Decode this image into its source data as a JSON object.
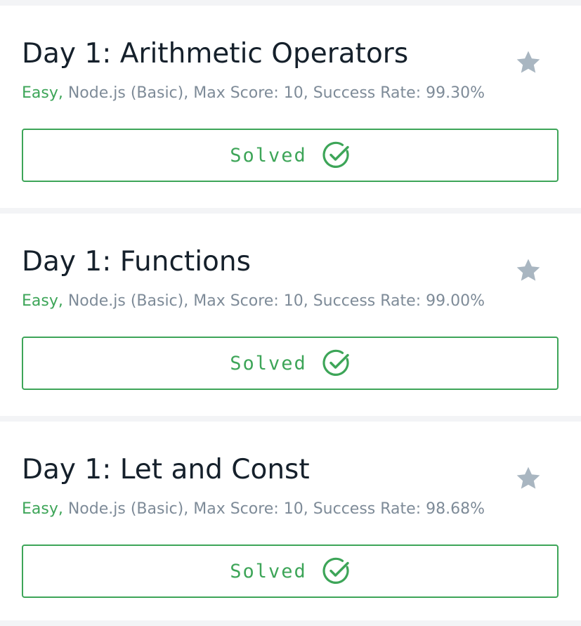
{
  "colors": {
    "accent_green": "#3da558",
    "meta_gray": "#7e8b98",
    "title_text": "#15202b",
    "star_gray": "#a9b6c1",
    "separator": "#f3f4f6"
  },
  "challenges": [
    {
      "title": "Day 1: Arithmetic Operators",
      "difficulty": "Easy,",
      "details": " Node.js (Basic), Max Score: 10, Success Rate: 99.30%",
      "status_label": "Solved",
      "star_icon": "star-icon",
      "status_icon": "check-circle-icon"
    },
    {
      "title": "Day 1: Functions",
      "difficulty": "Easy,",
      "details": " Node.js (Basic), Max Score: 10, Success Rate: 99.00%",
      "status_label": "Solved",
      "star_icon": "star-icon",
      "status_icon": "check-circle-icon"
    },
    {
      "title": "Day 1: Let and Const",
      "difficulty": "Easy,",
      "details": " Node.js (Basic), Max Score: 10, Success Rate: 98.68%",
      "status_label": "Solved",
      "star_icon": "star-icon",
      "status_icon": "check-circle-icon"
    }
  ]
}
